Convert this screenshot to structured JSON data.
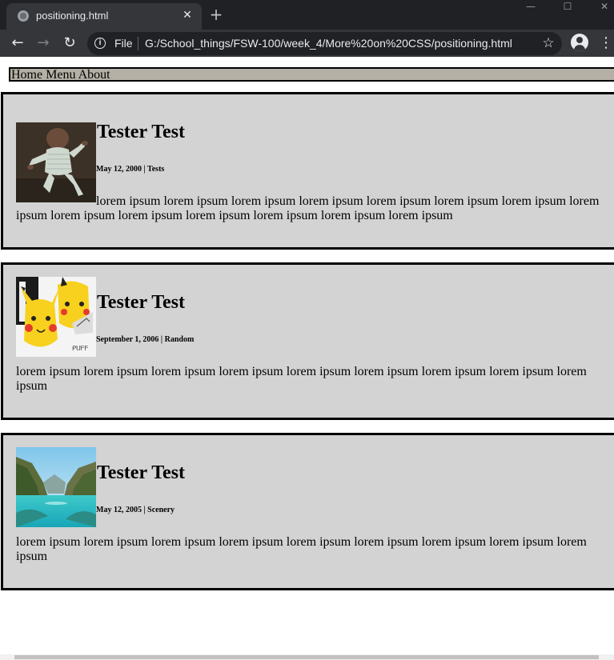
{
  "browser": {
    "tab_title": "positioning.html",
    "tab_close": "✕",
    "new_tab": "+",
    "window_controls": {
      "minimize": "—",
      "maximize": "☐",
      "close": "✕"
    },
    "nav": {
      "back": "←",
      "forward": "→",
      "reload": "↻"
    },
    "omnibox": {
      "info": "i",
      "scheme": "File",
      "url": "G:/School_things/FSW-100/week_4/More%20on%20CSS/positioning.html",
      "star": "☆"
    },
    "menu": "⋮"
  },
  "page": {
    "nav_items": [
      "Home",
      "Menu",
      "About"
    ],
    "posts": [
      {
        "title": "Tester Test",
        "date": "May 12, 2000",
        "separator": " | ",
        "category": "Tests",
        "body": "lorem ipsum lorem ipsum lorem ipsum lorem ipsum lorem ipsum lorem ipsum lorem ipsum lorem ipsum lorem ipsum lorem ipsum lorem ipsum lorem ipsum lorem ipsum lorem ipsum",
        "image": "dancing-baby-photo"
      },
      {
        "title": "Tester Test",
        "date": "September 1, 2006",
        "separator": " | ",
        "category": "Random",
        "body": "lorem ipsum lorem ipsum lorem ipsum lorem ipsum lorem ipsum lorem ipsum lorem ipsum lorem ipsum lorem ipsum",
        "image": "pikachu-collage"
      },
      {
        "title": "Tester Test",
        "date": "May 12, 2005",
        "separator": " | ",
        "category": "Scenery",
        "body": "lorem ipsum lorem ipsum lorem ipsum lorem ipsum lorem ipsum lorem ipsum lorem ipsum lorem ipsum lorem ipsum",
        "image": "mountain-lake-landscape"
      }
    ]
  },
  "colors": {
    "post_background": "#d3d3d3",
    "nav_background": "#b5b0a6",
    "border": "#000000"
  }
}
